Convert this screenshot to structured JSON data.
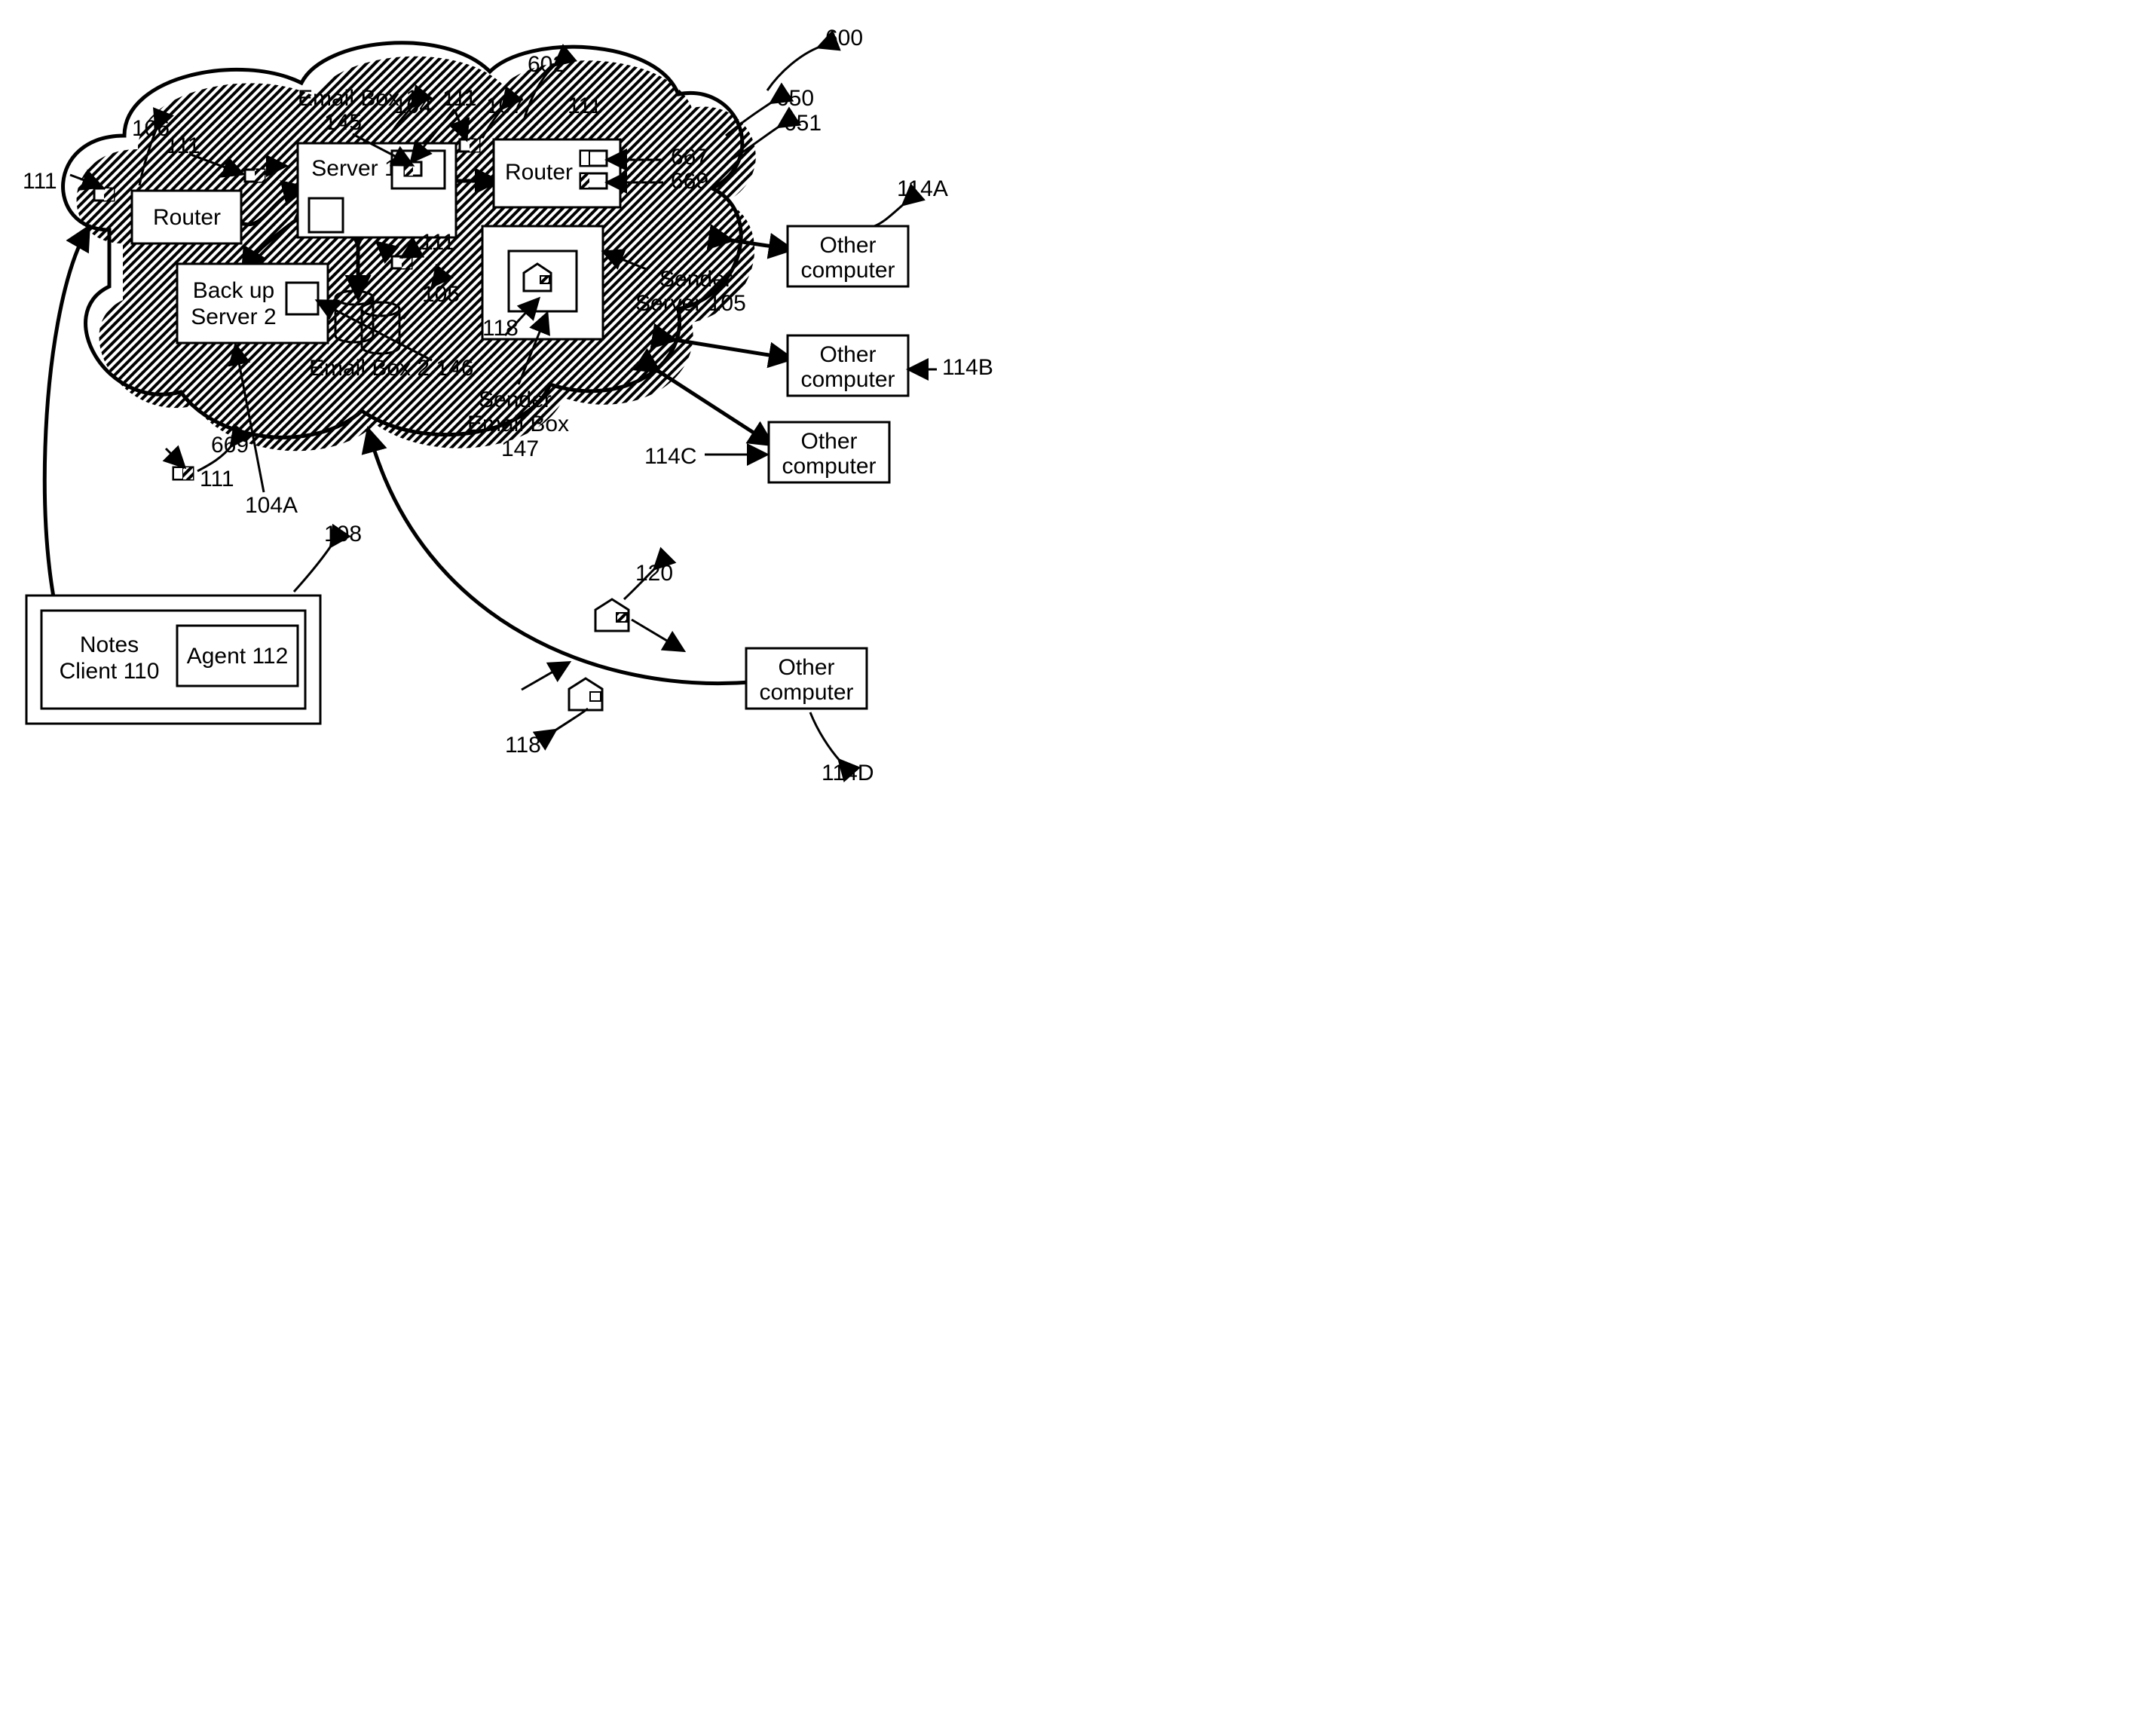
{
  "nodes": {
    "router_left": "Router",
    "router_right": "Router",
    "server1": "Server 1",
    "backup_line1": "Back up",
    "backup_line2": "Server 2",
    "notes_client_l1": "Notes",
    "notes_client_l2": "Client 110",
    "agent": "Agent 112",
    "other_computer": "Other",
    "other_computer2": "computer",
    "sender_server_l1": "Sender",
    "sender_server_l2": "Server 105",
    "sender_email_l1": "Sender",
    "sender_email_l2": "Email Box",
    "sender_email_l3": "147",
    "email_box1_l1": "Email Box 1",
    "email_box1_l2": "145",
    "email_box2": "Email Box 2 146"
  },
  "refs": {
    "r600": "600",
    "r602": "602",
    "r650": "650",
    "r651": "651",
    "r667": "667",
    "r669": "669",
    "r669b": "669",
    "r104": "104",
    "r104A": "104A",
    "r105": "105",
    "r106": "106",
    "r107": "107",
    "r108": "108",
    "r111": "111",
    "r118": "118",
    "r118b": "118",
    "r120": "120",
    "r114A": "114A",
    "r114B": "114B",
    "r114C": "114C",
    "r114D": "114D"
  }
}
